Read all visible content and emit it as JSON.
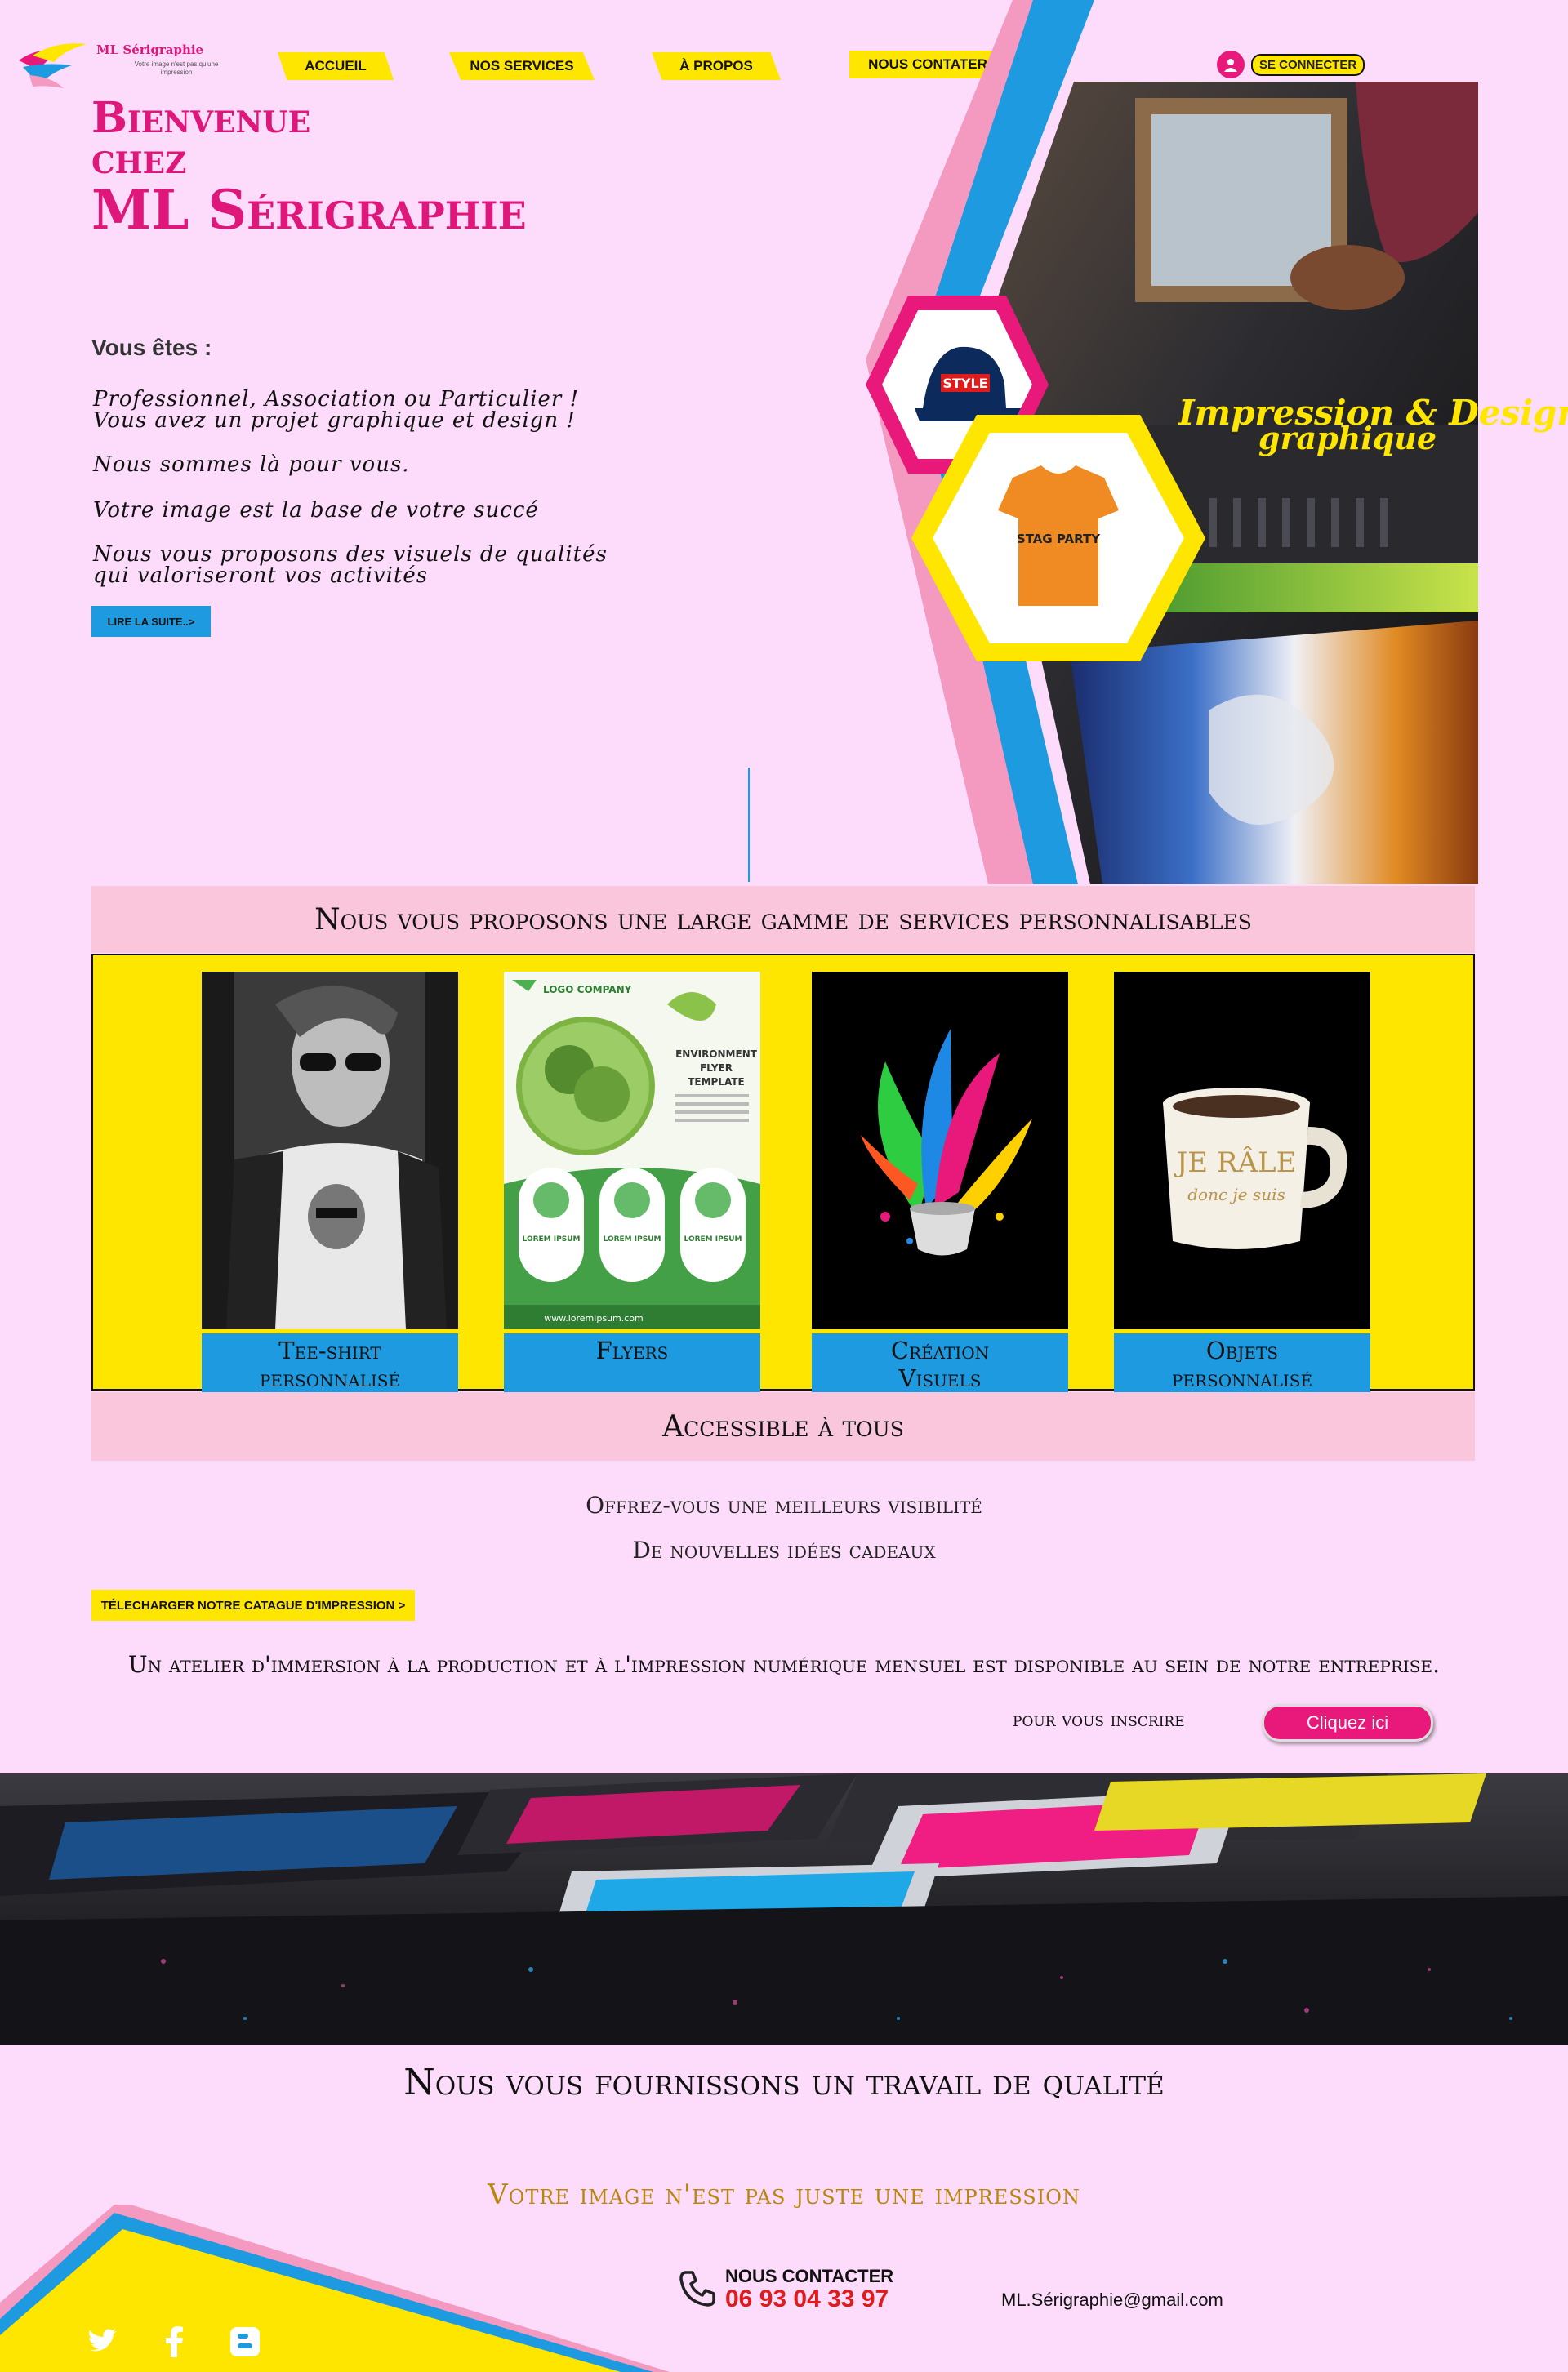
{
  "header": {
    "logo_title": "ML Sérigraphie",
    "logo_subtitle": "Votre image n'est pas qu'une impression",
    "nav": [
      {
        "label": "ACCUEIL"
      },
      {
        "label": "NOS SERVICES"
      },
      {
        "label": "À PROPOS"
      },
      {
        "label": "NOUS CONTATER"
      }
    ],
    "login_label": "SE CONNECTER"
  },
  "hero": {
    "title_line1": "Bienvenue",
    "title_line2": "chez",
    "title_line3": "ML Sérigraphie",
    "you_are": "Vous êtes :",
    "lines": [
      "Professionnel, Association ou Particulier !",
      "Vous avez un projet graphique et design !",
      "Nous sommes là pour vous.",
      "Votre image est la base de votre succé",
      "Nous vous proposons des visuels de qualités",
      "qui valoriseront vos activités"
    ],
    "read_more": "LIRE  LA SUITE..>",
    "image_caption_1": "Impression & Design",
    "image_caption_2": "graphique",
    "cap_text": "STYLE",
    "shirt_text": "STAG PARTY"
  },
  "services": {
    "banner": "Nous vous proposons une large gamme de services personnalisables",
    "items": [
      {
        "label_1": "Tee-shirt",
        "label_2": "personnalisé"
      },
      {
        "label_1": "Flyers",
        "label_2": ""
      },
      {
        "label_1": "Création",
        "label_2": "Visuels"
      },
      {
        "label_1": "Objets",
        "label_2": "personnalisé"
      }
    ],
    "flyer": {
      "company": "LOGO COMPANY",
      "heading_1": "ENVIRONMENT",
      "heading_2": "FLYER",
      "heading_3": "TEMPLATE",
      "box_label": "LOREM IPSUM",
      "url": "www.loremipsum.com"
    },
    "mug_text_1": "JE RÂLE",
    "mug_text_2": "donc je suis"
  },
  "access_banner": "Accessible à tous",
  "offer_line_1": "Offrez-vous une meilleurs visibilité",
  "offer_line_2": "De nouvelles idées cadeaux",
  "catalog_button": "TÉLECHARGER NOTRE CATAGUE D'IMPRESSION >",
  "atelier_text": "Un atelier d'immersion à la production et à l'impression numérique mensuel est disponible au sein de notre entreprise.",
  "signup": {
    "label": "pour vous inscrire",
    "button": "Cliquez ici"
  },
  "quality_heading": "Nous vous fournissons un travail de qualité",
  "tagline": "Votre image n'est pas juste une impression",
  "footer": {
    "contact_title": "NOUS CONTACTER",
    "phone": "06 93 04 33 97",
    "email": "ML.Sérigraphie@gmail.com",
    "social": [
      "twitter-icon",
      "facebook-icon",
      "blogger-icon"
    ]
  },
  "colors": {
    "background": "#fcdcfa",
    "magenta": "#e8197a",
    "yellow": "#ffe600",
    "cyan": "#1e9be0",
    "pink_banner": "#f9c6dc"
  }
}
